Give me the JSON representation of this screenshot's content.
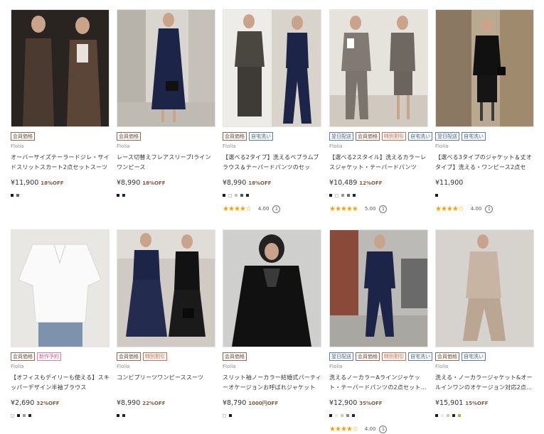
{
  "products": [
    {
      "tags": [
        {
          "text": "会員価格",
          "style": "brown"
        }
      ],
      "brand": "Flolia",
      "title": "オーバーサイズテーラードジレ・サイドスリットスカート2点セットスーツ",
      "price": "¥11,900",
      "off": "18%OFF",
      "swatches": [
        "#1a1a1a",
        "#8a5a3a"
      ],
      "rating": null
    },
    {
      "tags": [
        {
          "text": "会員価格",
          "style": "brown"
        }
      ],
      "brand": "Flolia",
      "title": "レース切替えフレアスリーブIラインワンピース",
      "price": "¥8,990",
      "off": "18%OFF",
      "swatches": [
        "#1a1a1a",
        "#1c2447"
      ],
      "rating": null
    },
    {
      "tags": [
        {
          "text": "会員価格",
          "style": "brown"
        },
        {
          "text": "自宅洗い",
          "style": "blue"
        }
      ],
      "brand": "Flolia",
      "title": "【選べる2タイプ】洗えるペプラムブラウス＆テーパードパンツのセット…",
      "price": "¥8,990",
      "off": "18%OFF",
      "swatches": [
        "#1a1a1a",
        "#ffffff",
        "#c8c0b0",
        "#555555",
        "#1c2447"
      ],
      "rating": {
        "stars": "★★★★☆",
        "value": "4.00",
        "count": "1"
      }
    },
    {
      "tags": [
        {
          "text": "翌日配送",
          "style": "blue"
        },
        {
          "text": "会員価格",
          "style": "brown"
        },
        {
          "text": "特別割引",
          "style": "red"
        },
        {
          "text": "自宅洗い",
          "style": "blue"
        }
      ],
      "brand": "Flolia",
      "title": "【選べる2スタイル】洗えるカラーレスジャケット・テーパードパンツor…",
      "price": "¥10,489",
      "off": "12%OFF",
      "swatches": [
        "#1a1a1a",
        "#ffffff",
        "#9a9a9a",
        "#6b6b6b",
        "#1c2447"
      ],
      "rating": {
        "stars": "★★★★★",
        "value": "5.00",
        "count": "1"
      }
    },
    {
      "tags": [
        {
          "text": "翌日配送",
          "style": "blue"
        },
        {
          "text": "自宅洗い",
          "style": "blue"
        }
      ],
      "brand": "Flolia",
      "title": "【選べる3タイプのジャケット＆丈オタイプ】洗える・ワンピース2点セッ…",
      "price": "¥11,900",
      "off": "",
      "swatches": [
        "#1a1a1a"
      ],
      "rating": {
        "stars": "★★★★☆",
        "value": "4.00",
        "count": "1"
      }
    },
    {
      "tags": [
        {
          "text": "会員価格",
          "style": "brown"
        },
        {
          "text": "新作予約",
          "style": "pink"
        }
      ],
      "brand": "Flolia",
      "title": "【オフィスもデイリーも使える】スキッパーデザイン半袖ブラウス",
      "price": "¥2,690",
      "off": "32%OFF",
      "swatches": [
        "#ffffff",
        "#1a1a1a",
        "#9a9a9a",
        "#1c2447"
      ],
      "rating": null
    },
    {
      "tags": [
        {
          "text": "会員価格",
          "style": "brown"
        },
        {
          "text": "特別割引",
          "style": "red"
        }
      ],
      "brand": "Flolia",
      "title": "コンビプリーツワンピーススーツ",
      "price": "¥8,990",
      "off": "22%OFF",
      "swatches": [
        "#1a1a1a",
        "#1c2447"
      ],
      "rating": null
    },
    {
      "tags": [
        {
          "text": "会員価格",
          "style": "brown"
        }
      ],
      "brand": "Flolia",
      "title": "スリット袖ノーカラー結婚式パーティーオケージョンお呼ばれジャケット",
      "price": "¥8,790",
      "off": "1000円OFF",
      "swatches": [
        "#ffffff",
        "#1a1a1a"
      ],
      "rating": null
    },
    {
      "tags": [
        {
          "text": "翌日配送",
          "style": "blue"
        },
        {
          "text": "会員価格",
          "style": "brown"
        },
        {
          "text": "特別割引",
          "style": "red"
        },
        {
          "text": "自宅洗い",
          "style": "blue"
        }
      ],
      "brand": "Flolia",
      "title": "洗えるノーカラーAラインジャケット・テーパードパンツの2点セット…",
      "price": "¥12,900",
      "off": "35%OFF",
      "swatches": [
        "#1a1a1a",
        "#f3e9d8",
        "#d9c8b0",
        "#8a8a8a",
        "#1c2447"
      ],
      "rating": {
        "stars": "★★★★☆",
        "value": "4.00",
        "count": "1"
      }
    },
    {
      "tags": [
        {
          "text": "会員価格",
          "style": "brown"
        },
        {
          "text": "自宅洗い",
          "style": "blue"
        }
      ],
      "brand": "Flolia",
      "title": "洗える・ノーカラージャケット&オールインワンのオケージョン対応2点…",
      "price": "¥15,901",
      "off": "15%OFF",
      "swatches": [
        "#1a1a1a",
        "#f3e9d8",
        "#d9c8b0",
        "#1c2447",
        "#c9a44a"
      ],
      "rating": null
    }
  ]
}
